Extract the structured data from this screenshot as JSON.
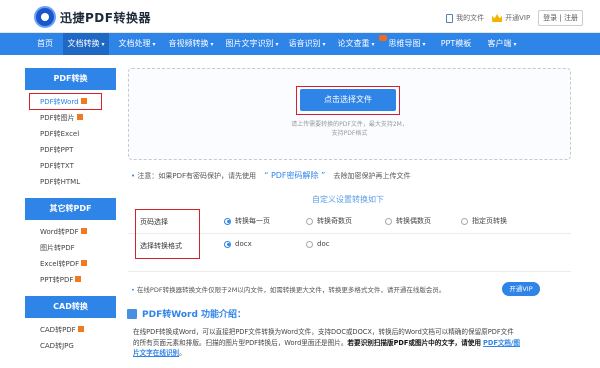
{
  "brand": {
    "name": "迅捷PDF转换器",
    "logo_icon": "logo-icon"
  },
  "top_links": {
    "my_files": "我的文件",
    "vip": "开通VIP",
    "login": "登录",
    "separator": "|",
    "register": "注册"
  },
  "nav": {
    "items": [
      {
        "label": "首页"
      },
      {
        "label": "文档转换",
        "arrow": "▾"
      },
      {
        "label": "文档处理",
        "arrow": "▾"
      },
      {
        "label": "音视频转换",
        "arrow": "▾"
      },
      {
        "label": "图片文字识别",
        "arrow": "▾"
      },
      {
        "label": "语音识别",
        "arrow": "▾"
      },
      {
        "label": "论文查重",
        "arrow": "▾"
      },
      {
        "label": "思维导图",
        "arrow": "▾"
      },
      {
        "label": "PPT模板"
      },
      {
        "label": "客户端",
        "arrow": "▾"
      }
    ]
  },
  "sidebar": {
    "group1": {
      "title": "PDF转换",
      "items": [
        "PDF转Word",
        "PDF转图片",
        "PDF转Excel",
        "PDF转PPT",
        "PDF转TXT",
        "PDF转HTML"
      ]
    },
    "group2": {
      "title": "其它转PDF",
      "items": [
        "Word转PDF",
        "图片转PDF",
        "Excel转PDF",
        "PPT转PDF"
      ]
    },
    "group3": {
      "title": "CAD转换",
      "items": [
        "CAD转PDF",
        "CAD转JPG"
      ]
    }
  },
  "upload": {
    "button": "点击选择文件",
    "tip_line1": "请上传需要转换的PDF文件，最大支持2M，",
    "tip_line2": "支持PDF格式"
  },
  "notice": {
    "bullet": "•",
    "prefix": "注意：如果PDF有密码保护，请先使用",
    "link": "“ PDF密码解除 ”",
    "suffix": "去除加密保护再上传文件"
  },
  "custom": {
    "title": "自定义设置转换如下"
  },
  "options": {
    "page_label": "页码选择",
    "page_choices": [
      "转换每一页",
      "转换奇数页",
      "转换偶数页",
      "指定页转换"
    ],
    "format_label": "选择转换格式",
    "format_choices": [
      "docx",
      "doc"
    ]
  },
  "vip_notice": {
    "bullet": "•",
    "text": "在线PDF转换器转换文件仅限于2M以内文件，如需转换更大文件，转换更多格式文件，请开通在线版会员。",
    "button": "开通VIP"
  },
  "intro": {
    "title": "PDF转Word 功能介绍：",
    "line1": "在线PDF转换成Word，可以直接把PDF文件转换为Word文件，支持DOC或DOCX，转换后的Word文档可以精确的保留原PDF文件",
    "line2": "的所有页面元素和排版。扫描的图片型PDF转换后，Word里面还是图片。",
    "bold": "若要识别扫描版PDF或图片中的文字，请使用",
    "link": "PDF文档/图",
    "line3": "片文字在线识别",
    "end": "。"
  }
}
